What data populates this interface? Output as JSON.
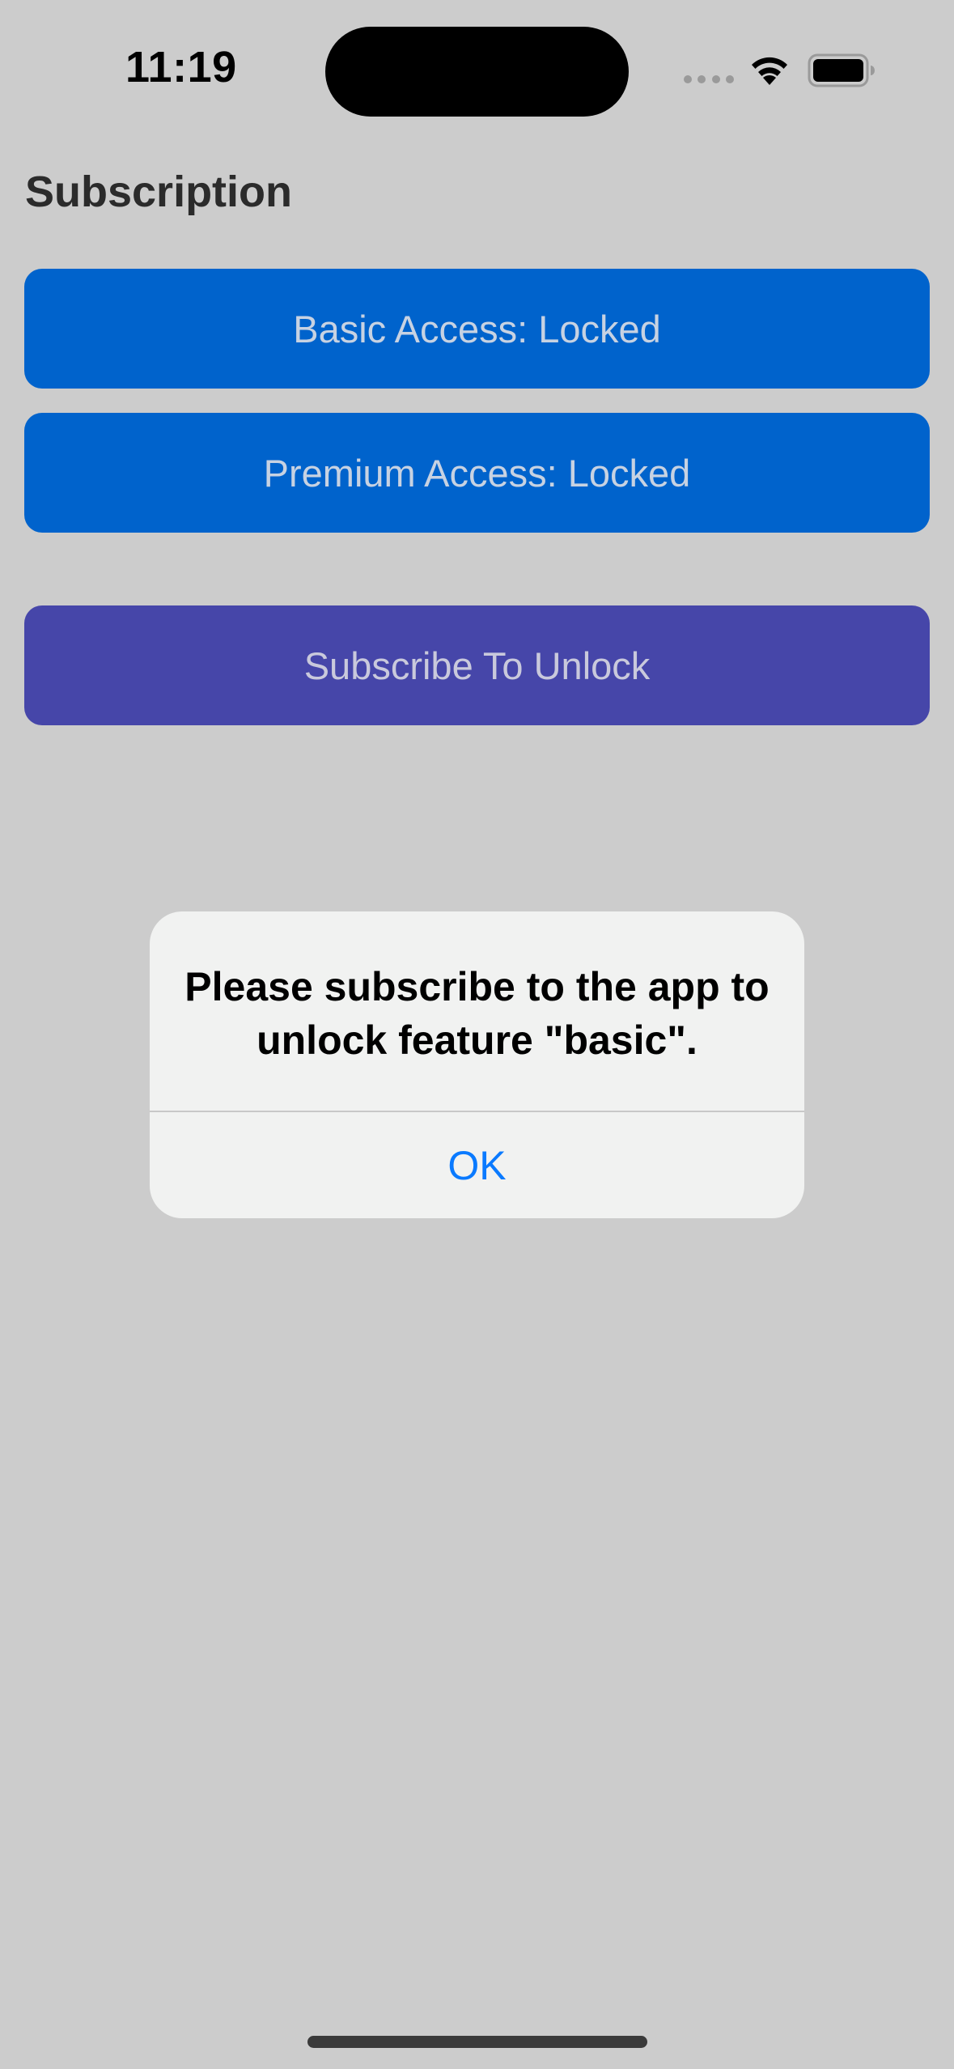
{
  "status_bar": {
    "time": "11:19",
    "wifi_icon": "wifi-icon",
    "battery_icon": "battery-icon"
  },
  "page": {
    "title": "Subscription"
  },
  "buttons": {
    "basic_access": "Basic Access: Locked",
    "premium_access": "Premium Access: Locked",
    "subscribe": "Subscribe To Unlock"
  },
  "alert": {
    "message": "Please subscribe to the app to unlock feature \"basic\".",
    "ok_label": "OK"
  },
  "colors": {
    "background": "#cccccc",
    "access_button": "#0063cc",
    "subscribe_button": "#4646a9",
    "alert_action": "#0a7aff"
  }
}
